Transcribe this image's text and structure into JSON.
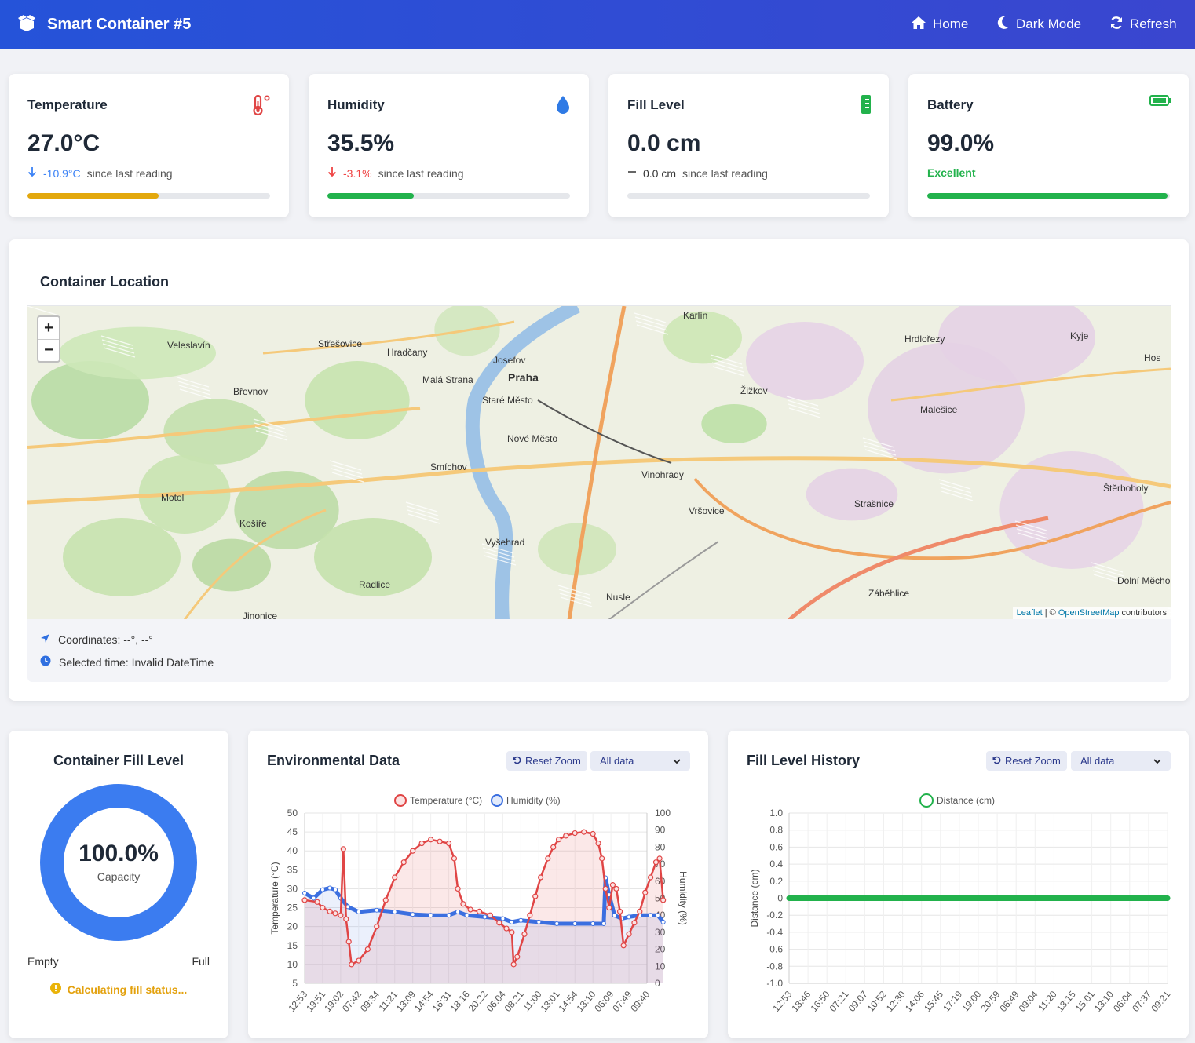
{
  "header": {
    "title": "Smart Container #5",
    "nav": {
      "home": "Home",
      "dark_mode": "Dark Mode",
      "refresh": "Refresh"
    }
  },
  "stats": {
    "temperature": {
      "title": "Temperature",
      "value": "27.0°C",
      "change": "-10.9°C",
      "suffix": "since last reading",
      "progress": 0.54,
      "color": "#eab308",
      "change_color": "#3b82f6"
    },
    "humidity": {
      "title": "Humidity",
      "value": "35.5%",
      "change": "-3.1%",
      "suffix": "since last reading",
      "progress": 0.355,
      "color": "#22c55e",
      "change_color": "#ef4444"
    },
    "fill": {
      "title": "Fill Level",
      "value": "0.0 cm",
      "change": "0.0 cm",
      "suffix": "since last reading",
      "progress": 0.0
    },
    "battery": {
      "title": "Battery",
      "value": "99.0%",
      "status": "Excellent",
      "progress": 0.99,
      "color": "#22c55e"
    }
  },
  "location": {
    "title": "Container Location",
    "coordinates": "Coordinates: --°, --°",
    "selected_time": "Selected time: Invalid DateTime",
    "attribution_leaflet": "Leaflet",
    "attribution_sep": " | © ",
    "attribution_osm": "OpenStreetMap",
    "attribution_tail": " contributors",
    "zoom_in": "+",
    "zoom_out": "−",
    "map_labels": [
      "Karlín",
      "Střešovice",
      "Hradčany",
      "Veleslavín",
      "Břevnov",
      "Josefov",
      "Praha",
      "Malá Strana",
      "Staré Město",
      "Nové Město",
      "Smíchov",
      "Vinohrady",
      "Žižkov",
      "Hrdlořezy",
      "Malešice",
      "Strašnice",
      "Vršovice",
      "Vyšehrad",
      "Motol",
      "Košíře",
      "Radlice",
      "Nusle",
      "Záběhlice",
      "Štěrboholy",
      "Kyje",
      "Dolní Měcho",
      "Jinonice",
      "Hos"
    ]
  },
  "fill_gauge": {
    "title": "Container Fill Level",
    "percent_text": "100.0%",
    "percent": 100,
    "caption": "Capacity",
    "empty": "Empty",
    "full": "Full",
    "status": "Calculating fill status...",
    "ring_color": "#3b7cf0",
    "status_color": "#eab308"
  },
  "env_chart": {
    "title": "Environmental Data",
    "reset": "Reset Zoom",
    "range": "All data",
    "legend_temp": "Temperature (°C)",
    "legend_hum": "Humidity (%)",
    "ylabel_left": "Temperature (°C)",
    "ylabel_right": "Humidity (%)"
  },
  "fill_chart": {
    "title": "Fill Level History",
    "reset": "Reset Zoom",
    "range": "All data",
    "legend": "Distance (cm)",
    "ylabel": "Distance (cm)"
  },
  "chart_data": [
    {
      "type": "line",
      "title": "Environmental Data",
      "ylabel": "Temperature (°C)",
      "y2label": "Humidity (%)",
      "ylim": [
        5,
        50
      ],
      "y2lim": [
        0,
        100
      ],
      "yticks": [
        5,
        10,
        15,
        20,
        25,
        30,
        35,
        40,
        45,
        50
      ],
      "y2ticks": [
        0,
        10,
        20,
        30,
        40,
        50,
        60,
        70,
        80,
        90,
        100
      ],
      "xticks": [
        "12:53",
        "19:51",
        "19:02",
        "07:42",
        "09:34",
        "11:21",
        "13:09",
        "14:54",
        "16:31",
        "18:16",
        "20:22",
        "06:04",
        "08:21",
        "11:00",
        "13:01",
        "14:54",
        "13:10",
        "06:09",
        "07:49",
        "09:40"
      ],
      "series": [
        {
          "name": "Temperature (°C)",
          "color": "#e04545",
          "points": [
            [
              0,
              27
            ],
            [
              0.7,
              26.5
            ],
            [
              1,
              25
            ],
            [
              1.4,
              24
            ],
            [
              1.7,
              23.5
            ],
            [
              2,
              23
            ],
            [
              2.15,
              40.5
            ],
            [
              2.3,
              22
            ],
            [
              2.45,
              16
            ],
            [
              2.6,
              10
            ],
            [
              3,
              11
            ],
            [
              3.5,
              14
            ],
            [
              4,
              20
            ],
            [
              4.5,
              27
            ],
            [
              5,
              33
            ],
            [
              5.5,
              37
            ],
            [
              6,
              40
            ],
            [
              6.5,
              42
            ],
            [
              7,
              43
            ],
            [
              7.5,
              42.5
            ],
            [
              8,
              42
            ],
            [
              8.3,
              38
            ],
            [
              8.5,
              30
            ],
            [
              8.8,
              26
            ],
            [
              9.2,
              24.5
            ],
            [
              9.7,
              24
            ],
            [
              10.3,
              23
            ],
            [
              10.8,
              21
            ],
            [
              11.2,
              19.5
            ],
            [
              11.5,
              18.5
            ],
            [
              11.6,
              10
            ],
            [
              11.8,
              12
            ],
            [
              12.2,
              18
            ],
            [
              12.5,
              23
            ],
            [
              12.8,
              28
            ],
            [
              13.1,
              33
            ],
            [
              13.5,
              38
            ],
            [
              13.8,
              41
            ],
            [
              14.1,
              43
            ],
            [
              14.5,
              44
            ],
            [
              15,
              44.7
            ],
            [
              15.5,
              45
            ],
            [
              16,
              44.5
            ],
            [
              16.3,
              42
            ],
            [
              16.5,
              38
            ],
            [
              16.7,
              30
            ],
            [
              16.9,
              25
            ],
            [
              17.1,
              31
            ],
            [
              17.3,
              30
            ],
            [
              17.5,
              24
            ],
            [
              17.7,
              15
            ],
            [
              18,
              18
            ],
            [
              18.3,
              21
            ],
            [
              18.6,
              24
            ],
            [
              18.9,
              29
            ],
            [
              19.2,
              33
            ],
            [
              19.5,
              37
            ],
            [
              19.7,
              38
            ],
            [
              19.9,
              27
            ]
          ]
        },
        {
          "name": "Humidity (%)",
          "color": "#3b6fe0",
          "points": [
            [
              0,
              53
            ],
            [
              0.5,
              50
            ],
            [
              1,
              55
            ],
            [
              1.4,
              56
            ],
            [
              1.7,
              55
            ],
            [
              2,
              50
            ],
            [
              2.4,
              45
            ],
            [
              3,
              42
            ],
            [
              4,
              43
            ],
            [
              5,
              42
            ],
            [
              6,
              40.5
            ],
            [
              7,
              40
            ],
            [
              8,
              40
            ],
            [
              8.5,
              42
            ],
            [
              9,
              40
            ],
            [
              10,
              39
            ],
            [
              11,
              38
            ],
            [
              11.5,
              36
            ],
            [
              12,
              37
            ],
            [
              13,
              36
            ],
            [
              14,
              35
            ],
            [
              15,
              35
            ],
            [
              16,
              35
            ],
            [
              16.6,
              35
            ],
            [
              16.7,
              62
            ],
            [
              16.9,
              52
            ],
            [
              17.2,
              40
            ],
            [
              17.6,
              38
            ],
            [
              18,
              39
            ],
            [
              18.6,
              40
            ],
            [
              19.2,
              40
            ],
            [
              19.6,
              40
            ],
            [
              19.9,
              36
            ]
          ]
        }
      ]
    },
    {
      "type": "line",
      "title": "Fill Level History",
      "ylabel": "Distance (cm)",
      "ylim": [
        -1.0,
        1.0
      ],
      "yticks": [
        "1.0",
        "0.8",
        "0.6",
        "0.4",
        "0.2",
        "0",
        "-0.2",
        "-0.4",
        "-0.6",
        "-0.8",
        "-1.0"
      ],
      "xticks": [
        "12:53",
        "18:46",
        "16:50",
        "07:21",
        "09:07",
        "10:52",
        "12:30",
        "14:06",
        "15:45",
        "17:19",
        "19:00",
        "20:59",
        "06:49",
        "09:04",
        "11:20",
        "13:15",
        "15:01",
        "13:10",
        "06:04",
        "07:37",
        "09:21"
      ],
      "series": [
        {
          "name": "Distance (cm)",
          "color": "#22b24c",
          "values_constant": 0
        }
      ]
    }
  ]
}
